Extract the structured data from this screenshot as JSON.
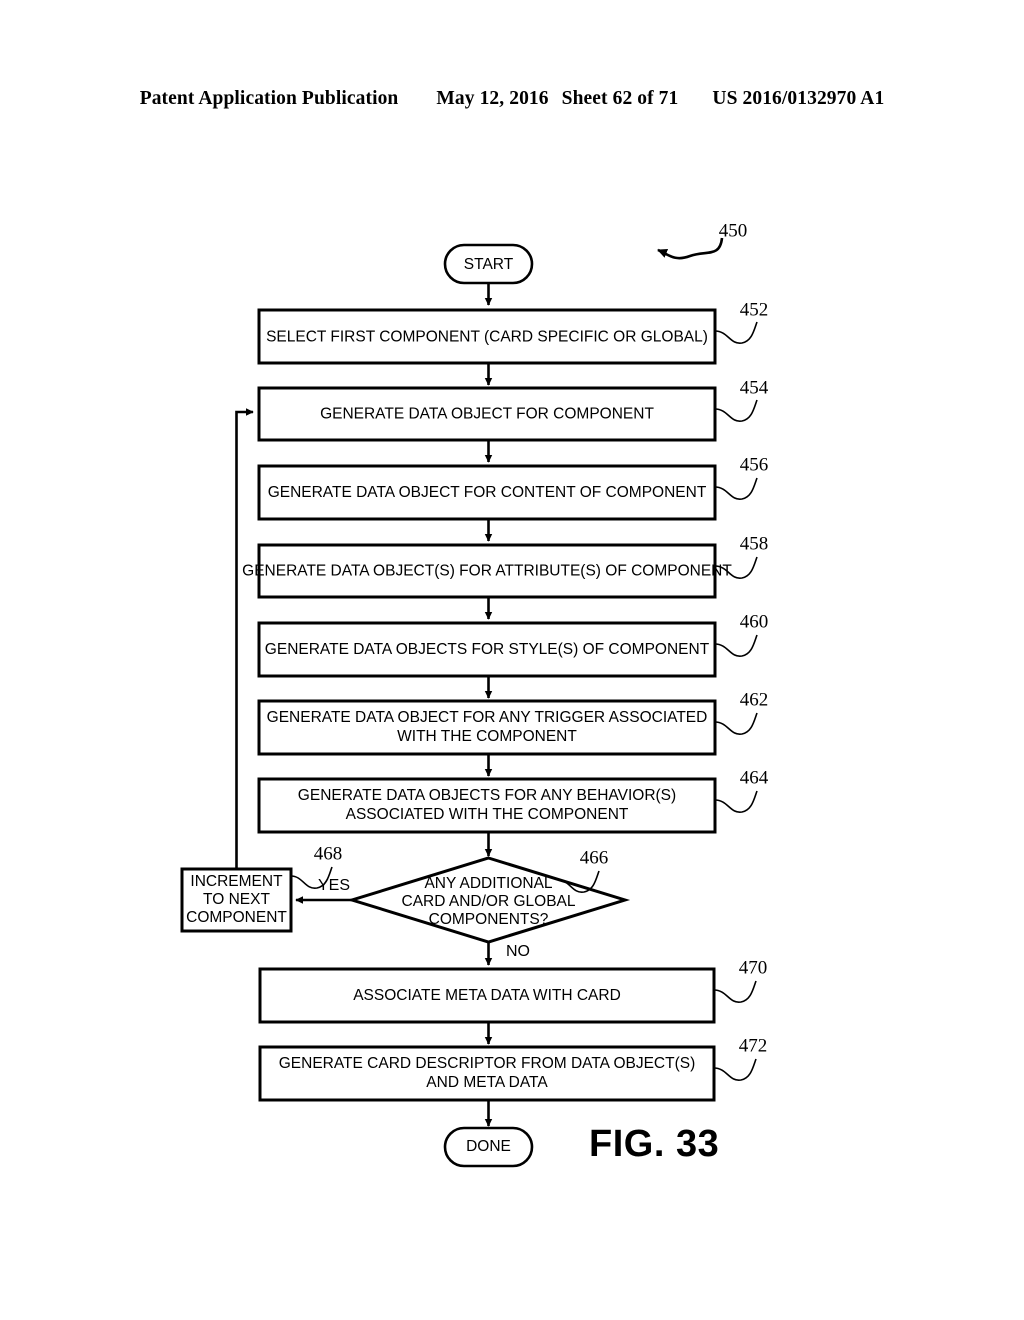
{
  "header": {
    "publication": "Patent Application Publication",
    "date": "May 12, 2016",
    "sheet": "Sheet 62 of 71",
    "patent_number": "US 2016/0132970 A1"
  },
  "figure": {
    "caption": "FIG. 33",
    "diagram_ref": "450"
  },
  "nodes": {
    "start": {
      "label": "START",
      "type": "terminator"
    },
    "n452": {
      "ref": "452",
      "type": "process",
      "lines": [
        "SELECT FIRST COMPONENT (CARD SPECIFIC OR GLOBAL)"
      ]
    },
    "n454": {
      "ref": "454",
      "type": "process",
      "lines": [
        "GENERATE DATA OBJECT FOR COMPONENT"
      ]
    },
    "n456": {
      "ref": "456",
      "type": "process",
      "lines": [
        "GENERATE DATA OBJECT FOR CONTENT OF COMPONENT"
      ]
    },
    "n458": {
      "ref": "458",
      "type": "process",
      "lines": [
        "GENERATE DATA OBJECT(S) FOR ATTRIBUTE(S) OF COMPONENT"
      ]
    },
    "n460": {
      "ref": "460",
      "type": "process",
      "lines": [
        "GENERATE DATA OBJECTS FOR STYLE(S) OF COMPONENT"
      ]
    },
    "n462": {
      "ref": "462",
      "type": "process",
      "lines": [
        "GENERATE DATA OBJECT FOR ANY TRIGGER ASSOCIATED",
        "WITH THE COMPONENT"
      ]
    },
    "n464": {
      "ref": "464",
      "type": "process",
      "lines": [
        "GENERATE DATA OBJECTS FOR ANY BEHAVIOR(S)",
        "ASSOCIATED WITH THE COMPONENT"
      ]
    },
    "n466": {
      "ref": "466",
      "type": "decision",
      "lines": [
        "ANY ADDITIONAL",
        "CARD AND/OR GLOBAL",
        "COMPONENTS?"
      ]
    },
    "n468": {
      "ref": "468",
      "type": "process",
      "lines": [
        "INCREMENT",
        "TO NEXT",
        "COMPONENT"
      ]
    },
    "n470": {
      "ref": "470",
      "type": "process",
      "lines": [
        "ASSOCIATE META DATA WITH CARD"
      ]
    },
    "n472": {
      "ref": "472",
      "type": "process",
      "lines": [
        "GENERATE CARD DESCRIPTOR FROM DATA OBJECT(S)",
        "AND META DATA"
      ]
    },
    "done": {
      "label": "DONE",
      "type": "terminator"
    }
  },
  "branches": {
    "yes": "YES",
    "no": "NO"
  },
  "colors": {
    "ink": "#000000",
    "paper": "#ffffff"
  }
}
